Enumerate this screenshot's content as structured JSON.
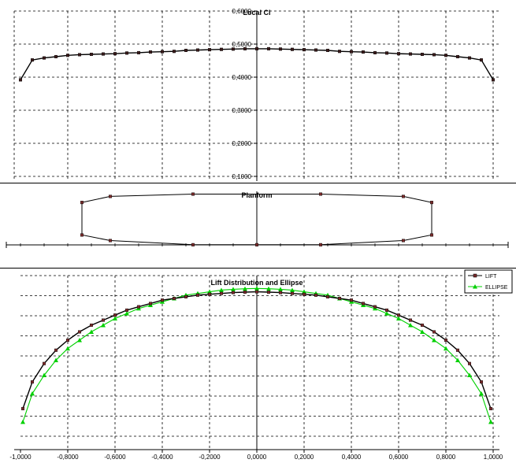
{
  "chart_data": [
    {
      "type": "line",
      "title": "Local Cl",
      "xlim": [
        -1.0,
        1.0
      ],
      "ylim": [
        0.1,
        0.6
      ],
      "yticks": [
        "0,1000",
        "0,2000",
        "0,3000",
        "0,4000",
        "0,5000",
        "0,6000"
      ],
      "grid": true,
      "series": [
        {
          "color": "#000000",
          "marker": "square",
          "x": [
            -1.0,
            -0.95,
            -0.9,
            -0.85,
            -0.8,
            -0.75,
            -0.7,
            -0.65,
            -0.6,
            -0.55,
            -0.5,
            -0.45,
            -0.4,
            -0.35,
            -0.3,
            -0.25,
            -0.2,
            -0.15,
            -0.1,
            -0.05,
            0.0,
            0.05,
            0.1,
            0.15,
            0.2,
            0.25,
            0.3,
            0.35,
            0.4,
            0.45,
            0.5,
            0.55,
            0.6,
            0.65,
            0.7,
            0.75,
            0.8,
            0.85,
            0.9,
            0.95,
            1.0
          ],
          "values": [
            0.392,
            0.452,
            0.458,
            0.462,
            0.466,
            0.468,
            0.469,
            0.47,
            0.471,
            0.473,
            0.474,
            0.476,
            0.477,
            0.478,
            0.481,
            0.482,
            0.483,
            0.484,
            0.485,
            0.486,
            0.486,
            0.486,
            0.485,
            0.484,
            0.483,
            0.482,
            0.481,
            0.478,
            0.477,
            0.476,
            0.474,
            0.473,
            0.471,
            0.47,
            0.469,
            0.468,
            0.466,
            0.462,
            0.458,
            0.452,
            0.392
          ]
        }
      ]
    },
    {
      "type": "line",
      "title": "Planform",
      "xlim": [
        -1.0,
        1.0
      ],
      "ylim": [
        -0.6,
        0.6
      ],
      "series": [
        {
          "color": "#000000",
          "marker": "square",
          "x": [
            -0.74,
            -0.62,
            -0.27,
            0.27,
            0.62,
            0.74,
            0.74,
            0.62,
            0.27,
            0.0,
            -0.27,
            -0.62,
            -0.74,
            -0.74
          ],
          "values": [
            0.32,
            0.45,
            0.5,
            0.5,
            0.45,
            0.32,
            -0.38,
            -0.5,
            -0.59,
            -0.59,
            -0.59,
            -0.5,
            -0.38,
            0.32
          ]
        }
      ]
    },
    {
      "type": "line",
      "title": "Lift Distribution and Ellipse",
      "xlim": [
        -1.0,
        1.0
      ],
      "ylim": [
        0.0,
        1.0
      ],
      "xticks": [
        "-1,0000",
        "-0,8000",
        "-0,6000",
        "-0,4000",
        "-0,2000",
        "0,0000",
        "0,2000",
        "0,4000",
        "0,6000",
        "0,8000",
        "1,0000"
      ],
      "grid": true,
      "legend": "top-right",
      "series": [
        {
          "name": "LIFT",
          "color": "#000000",
          "marker": "square",
          "x": [
            -0.99,
            -0.95,
            -0.9,
            -0.85,
            -0.8,
            -0.75,
            -0.7,
            -0.65,
            -0.6,
            -0.55,
            -0.5,
            -0.45,
            -0.4,
            -0.35,
            -0.3,
            -0.25,
            -0.2,
            -0.15,
            -0.1,
            -0.05,
            0.0,
            0.05,
            0.1,
            0.15,
            0.2,
            0.25,
            0.3,
            0.35,
            0.4,
            0.45,
            0.5,
            0.55,
            0.6,
            0.65,
            0.7,
            0.75,
            0.8,
            0.85,
            0.9,
            0.95,
            0.99
          ],
          "values": [
            0.17,
            0.33,
            0.44,
            0.52,
            0.58,
            0.63,
            0.67,
            0.7,
            0.73,
            0.76,
            0.78,
            0.8,
            0.82,
            0.83,
            0.84,
            0.85,
            0.855,
            0.86,
            0.865,
            0.868,
            0.87,
            0.868,
            0.865,
            0.86,
            0.855,
            0.85,
            0.84,
            0.83,
            0.82,
            0.8,
            0.78,
            0.76,
            0.73,
            0.7,
            0.67,
            0.63,
            0.58,
            0.52,
            0.44,
            0.33,
            0.17
          ]
        },
        {
          "name": "ELLIPSE",
          "color": "#00d000",
          "marker": "triangle",
          "x": [
            -0.99,
            -0.95,
            -0.9,
            -0.85,
            -0.8,
            -0.75,
            -0.7,
            -0.65,
            -0.6,
            -0.55,
            -0.5,
            -0.45,
            -0.4,
            -0.35,
            -0.3,
            -0.25,
            -0.2,
            -0.15,
            -0.1,
            -0.05,
            0.0,
            0.05,
            0.1,
            0.15,
            0.2,
            0.25,
            0.3,
            0.35,
            0.4,
            0.45,
            0.5,
            0.55,
            0.6,
            0.65,
            0.7,
            0.75,
            0.8,
            0.85,
            0.9,
            0.95,
            0.99
          ],
          "values": [
            0.09,
            0.26,
            0.37,
            0.46,
            0.53,
            0.58,
            0.63,
            0.67,
            0.71,
            0.74,
            0.77,
            0.79,
            0.81,
            0.83,
            0.85,
            0.86,
            0.87,
            0.88,
            0.885,
            0.888,
            0.89,
            0.888,
            0.885,
            0.88,
            0.87,
            0.86,
            0.85,
            0.83,
            0.81,
            0.79,
            0.77,
            0.74,
            0.71,
            0.67,
            0.63,
            0.58,
            0.53,
            0.46,
            0.37,
            0.26,
            0.09
          ]
        }
      ]
    }
  ]
}
